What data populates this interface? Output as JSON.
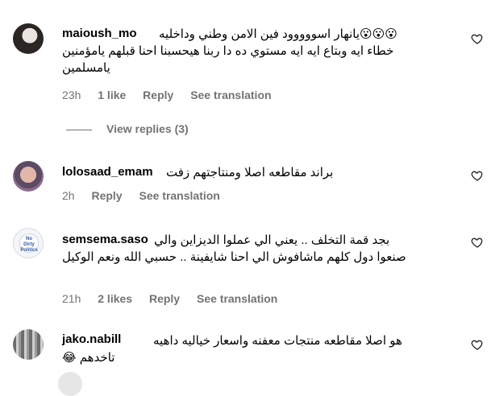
{
  "comments": [
    {
      "username": "maioush_mo",
      "text_line1": "😮😮😮يانهار اسووووود فين الامن وطني وداخليه",
      "text_rest": "خطاء ايه وبتاع ايه ايه مستوي ده دا ربنا هيحسبنا احنا قبلهم يامؤمنين يامسلمين",
      "time": "23h",
      "likes": "1 like",
      "reply": "Reply",
      "translate": "See translation"
    },
    {
      "username": "lolosaad_emam",
      "text_line1": "براند مقاطعه اصلا ومنتاجتهم زفت",
      "text_rest": "",
      "time": "2h",
      "likes": "",
      "reply": "Reply",
      "translate": "See translation"
    },
    {
      "username": "semsema.saso",
      "text_line1": "بجد قمة التخلف .. يعني الي عملوا الديزاين والي",
      "text_rest": "صنعوا دول كلهم ماشافوش الي احنا شايفينة .. حسبي الله ونعم الوكيل",
      "time": "21h",
      "likes": "2 likes",
      "reply": "Reply",
      "translate": "See translation"
    },
    {
      "username": "jako.nabill",
      "text_line1": "هو اصلا مقاطعه منتجات معفنه واسعار خياليه داهيه",
      "text_rest": "تاخدهم 😂",
      "time": "",
      "likes": "",
      "reply": "",
      "translate": ""
    }
  ],
  "view_replies": "View replies (3)",
  "avatar3_badge": "No Dirty Politics",
  "icons": {
    "like": "heart-outline-icon"
  },
  "colors": {
    "text": "#000000",
    "secondary": "#737373",
    "background": "#ffffff"
  }
}
